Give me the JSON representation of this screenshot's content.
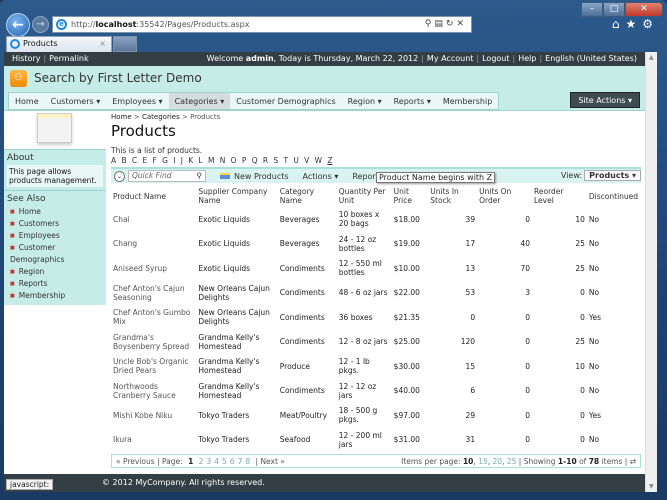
{
  "browser": {
    "url_prefix": "http://",
    "url_host": "localhost",
    "url_rest": ":35542/Pages/Products.aspx",
    "tab_title": "Products",
    "status_text": "javascript:"
  },
  "topbar": {
    "history": "History",
    "permalink": "Permalink",
    "welcome": "Welcome ",
    "user": "admin",
    "date_text": ", Today is Thursday, March 22, 2012",
    "my_account": "My Account",
    "logout": "Logout",
    "help": "Help",
    "language": "English (United States)"
  },
  "header": {
    "title": "Search by First Letter Demo"
  },
  "menu": {
    "items": [
      "Home",
      "Customers ▾",
      "Employees ▾",
      "Categories ▾",
      "Customer Demographics",
      "Region ▾",
      "Reports ▾",
      "Membership"
    ],
    "site_actions": "Site Actions ▾"
  },
  "sidebar": {
    "about_title": "About",
    "about_text": "This page allows products management.",
    "see_also_title": "See Also",
    "links": [
      "Home",
      "Customers",
      "Employees",
      "Customer Demographics",
      "Region",
      "Reports",
      "Membership"
    ]
  },
  "main": {
    "breadcrumb": {
      "home": "Home",
      "categories": "Categories",
      "current": "Products",
      "sep": " > "
    },
    "title": "Products",
    "description": "This is a list of products.",
    "letters": [
      "A",
      "B",
      "C",
      "E",
      "F",
      "G",
      "I",
      "J",
      "K",
      "L",
      "M",
      "N",
      "O",
      "P",
      "Q",
      "R",
      "S",
      "T",
      "U",
      "V",
      "W",
      "Z"
    ],
    "selected_letter": "Z"
  },
  "toolbar": {
    "quick_find_placeholder": "Quick Find",
    "new_products": "New Products",
    "actions": "Actions ▾",
    "report": "Report ▾",
    "tooltip": "Product Name begins with Z",
    "view_label": "View:",
    "view_value": "Products ▾"
  },
  "table": {
    "headers": [
      "Product Name",
      "Supplier Company Name",
      "Category Name",
      "Quantity Per Unit",
      "Unit Price",
      "Units In Stock",
      "Units On Order",
      "Reorder Level",
      "Discontinued"
    ],
    "rows": [
      [
        "Chai",
        "Exotic Liquids",
        "Beverages",
        "10 boxes x 20 bags",
        "$18.00",
        "39",
        "0",
        "10",
        "No"
      ],
      [
        "Chang",
        "Exotic Liquids",
        "Beverages",
        "24 - 12 oz bottles",
        "$19.00",
        "17",
        "40",
        "25",
        "No"
      ],
      [
        "Aniseed Syrup",
        "Exotic Liquids",
        "Condiments",
        "12 - 550 ml bottles",
        "$10.00",
        "13",
        "70",
        "25",
        "No"
      ],
      [
        "Chef Anton's Cajun Seasoning",
        "New Orleans Cajun Delights",
        "Condiments",
        "48 - 6 oz jars",
        "$22.00",
        "53",
        "3",
        "0",
        "No"
      ],
      [
        "Chef Anton's Gumbo Mix",
        "New Orleans Cajun Delights",
        "Condiments",
        "36 boxes",
        "$21.35",
        "0",
        "0",
        "0",
        "Yes"
      ],
      [
        "Grandma's Boysenberry Spread",
        "Grandma Kelly's Homestead",
        "Condiments",
        "12 - 8 oz jars",
        "$25.00",
        "120",
        "0",
        "25",
        "No"
      ],
      [
        "Uncle Bob's Organic Dried Pears",
        "Grandma Kelly's Homestead",
        "Produce",
        "12 - 1 lb pkgs.",
        "$30.00",
        "15",
        "0",
        "10",
        "No"
      ],
      [
        "Northwoods Cranberry Sauce",
        "Grandma Kelly's Homestead",
        "Condiments",
        "12 - 12 oz jars",
        "$40.00",
        "6",
        "0",
        "0",
        "No"
      ],
      [
        "Mishi Kobe Niku",
        "Tokyo Traders",
        "Meat/Poultry",
        "18 - 500 g pkgs.",
        "$97.00",
        "29",
        "0",
        "0",
        "Yes"
      ],
      [
        "Ikura",
        "Tokyo Traders",
        "Seafood",
        "12 - 200 ml jars",
        "$31.00",
        "31",
        "0",
        "0",
        "No"
      ]
    ]
  },
  "pager": {
    "previous": "« Previous",
    "page_label": "| Page:",
    "current_page": "1",
    "pages": [
      "2",
      "3",
      "4",
      "5",
      "6",
      "7",
      "8"
    ],
    "next": "| Next »",
    "items_per_page_label": "Items per page:",
    "current_size": "10",
    "sizes": [
      "15",
      "20",
      "25"
    ],
    "showing_label": "| Showing",
    "range": "1-10",
    "of": "of",
    "total": "78",
    "items": "items |"
  },
  "footer": {
    "copyright": "© 2012 MyCompany. All rights reserved."
  }
}
